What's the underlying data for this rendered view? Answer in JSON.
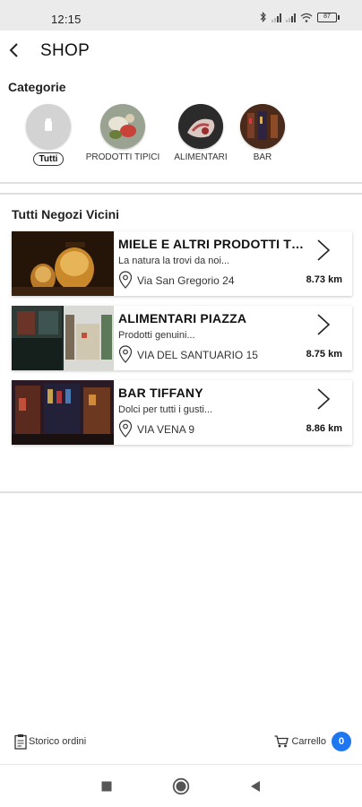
{
  "status_bar": {
    "time": "12:15",
    "battery": "87",
    "icons": [
      "bluetooth-icon",
      "signal-icon",
      "signal-icon",
      "wifi-icon",
      "battery-icon"
    ]
  },
  "header": {
    "title": "SHOP",
    "back_icon": "back-arrow-icon"
  },
  "categories": {
    "label": "Categorie",
    "items": [
      {
        "label": "Tutti",
        "selected": true
      },
      {
        "label": "PRODOTTI TIPICI",
        "selected": false
      },
      {
        "label": "ALIMENTARI",
        "selected": false
      },
      {
        "label": "BAR",
        "selected": false
      }
    ]
  },
  "shops": {
    "title": "Tutti Negozi Vicini",
    "items": [
      {
        "name": "MIELE E ALTRI PRODOTTI TIPICI",
        "description": "La natura la trovi da noi...",
        "address": "Via San Gregorio 24",
        "distance": "8.73 km"
      },
      {
        "name": "ALIMENTARI PIAZZA",
        "description": "Prodotti genuini...",
        "address": "VIA DEL SANTUARIO 15",
        "distance": "8.75 km"
      },
      {
        "name": "BAR TIFFANY",
        "description": "Dolci per tutti i gusti...",
        "address": "VIA VENA 9",
        "distance": "8.86 km"
      }
    ]
  },
  "bottom_bar": {
    "orders_label": "Storico ordini",
    "cart_label": "Carrello",
    "cart_count": "0"
  },
  "colors": {
    "accent": "#1e77f0",
    "status_bar_bg": "#ebebeb"
  }
}
